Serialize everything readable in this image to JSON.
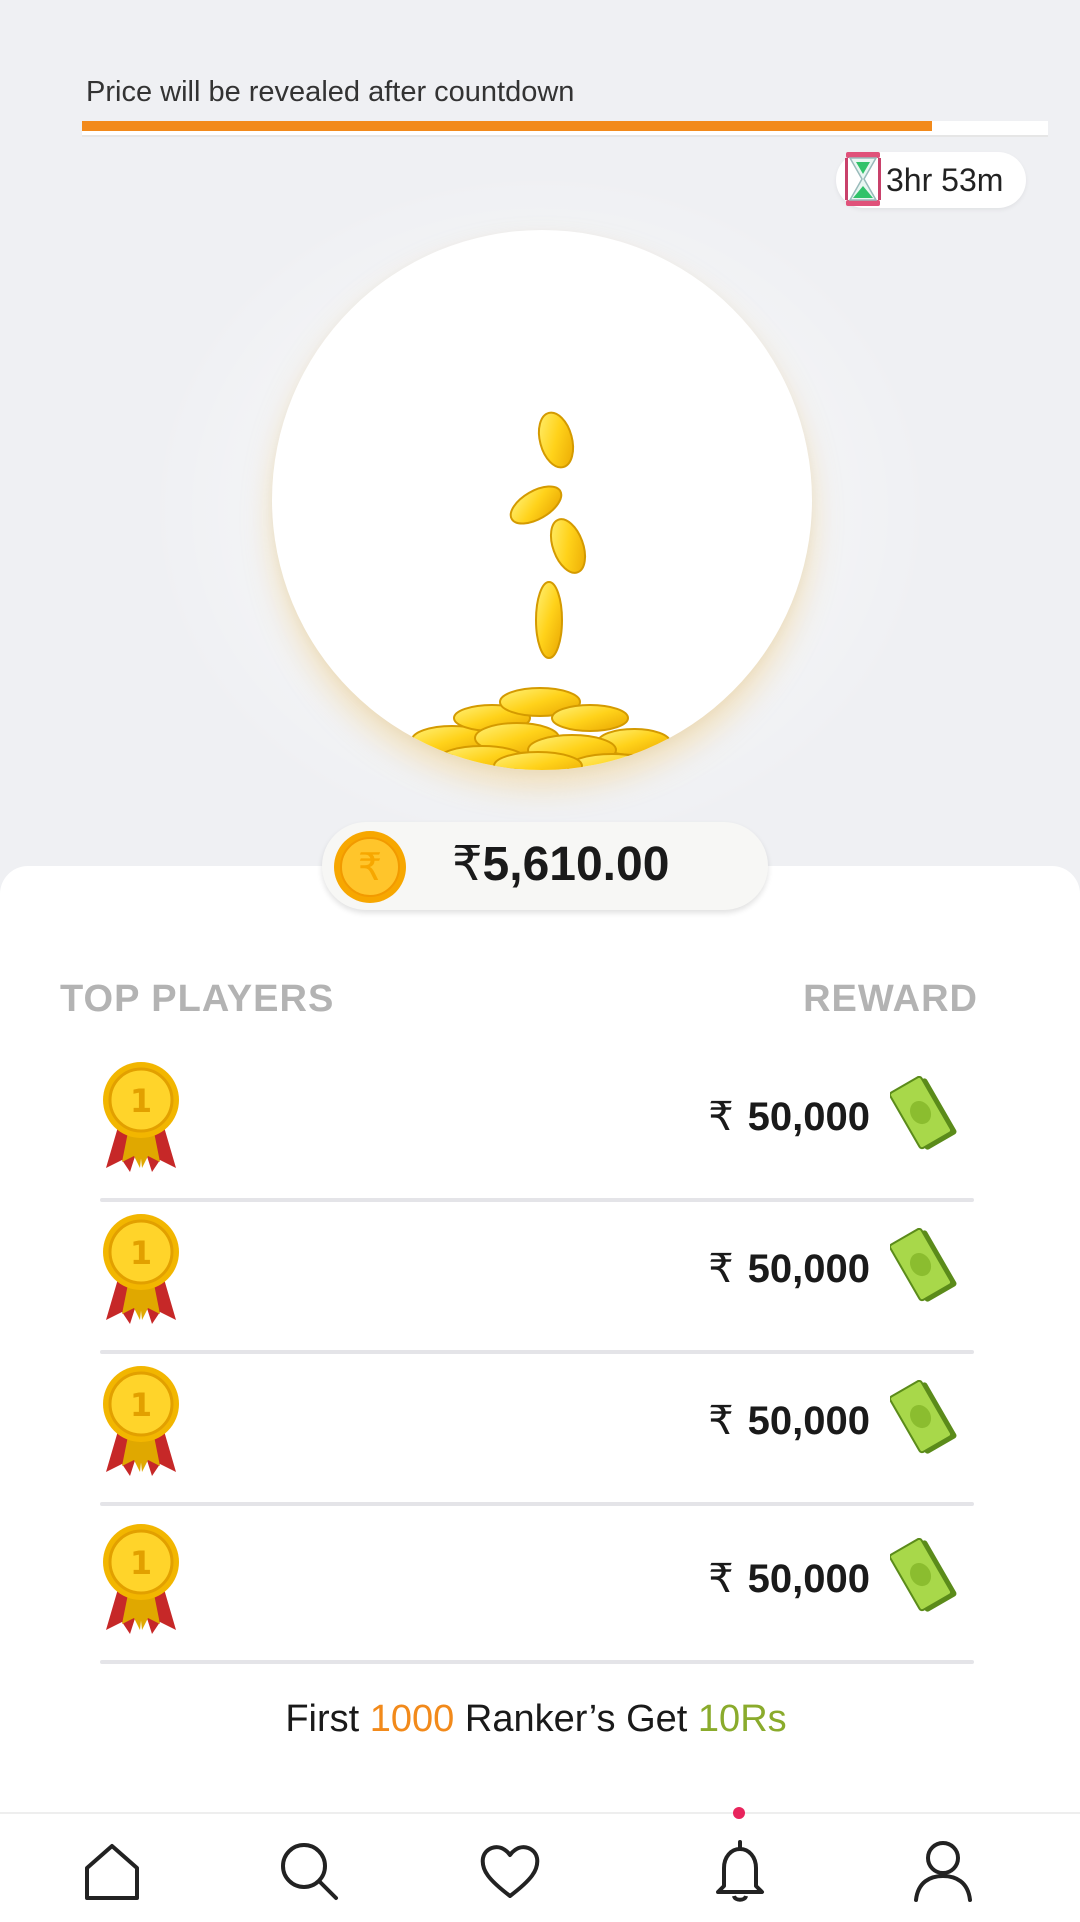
{
  "countdown": {
    "label": "Price will be revealed after countdown",
    "progress_percent": 88,
    "time_left": "3hr 53m"
  },
  "prize": {
    "currency_symbol": "₹",
    "amount": "5,610.00"
  },
  "leaderboard": {
    "left_header": "TOP PLAYERS",
    "right_header": "REWARD",
    "rows": [
      {
        "rank_icon": "gold-medal-icon",
        "currency_symbol": "₹",
        "reward": "50,000",
        "reward_icon": "cash-icon"
      },
      {
        "rank_icon": "gold-medal-icon",
        "currency_symbol": "₹",
        "reward": "50,000",
        "reward_icon": "cash-icon"
      },
      {
        "rank_icon": "gold-medal-icon",
        "currency_symbol": "₹",
        "reward": "50,000",
        "reward_icon": "cash-icon"
      },
      {
        "rank_icon": "gold-medal-icon",
        "currency_symbol": "₹",
        "reward": "50,000",
        "reward_icon": "cash-icon"
      }
    ]
  },
  "footer_note": {
    "part1": "First ",
    "highlight_count": "1000",
    "part2": " Ranker’s Get ",
    "highlight_reward": "10Rs"
  },
  "bottom_nav": {
    "items": [
      "home-icon",
      "search-icon",
      "heart-icon",
      "bell-icon",
      "profile-icon"
    ],
    "active_badge_on": "bell-icon"
  },
  "colors": {
    "accent_orange": "#f28a1b",
    "accent_green": "#8aab2c",
    "notification_dot": "#e8245c",
    "background": "#eff0f3"
  }
}
